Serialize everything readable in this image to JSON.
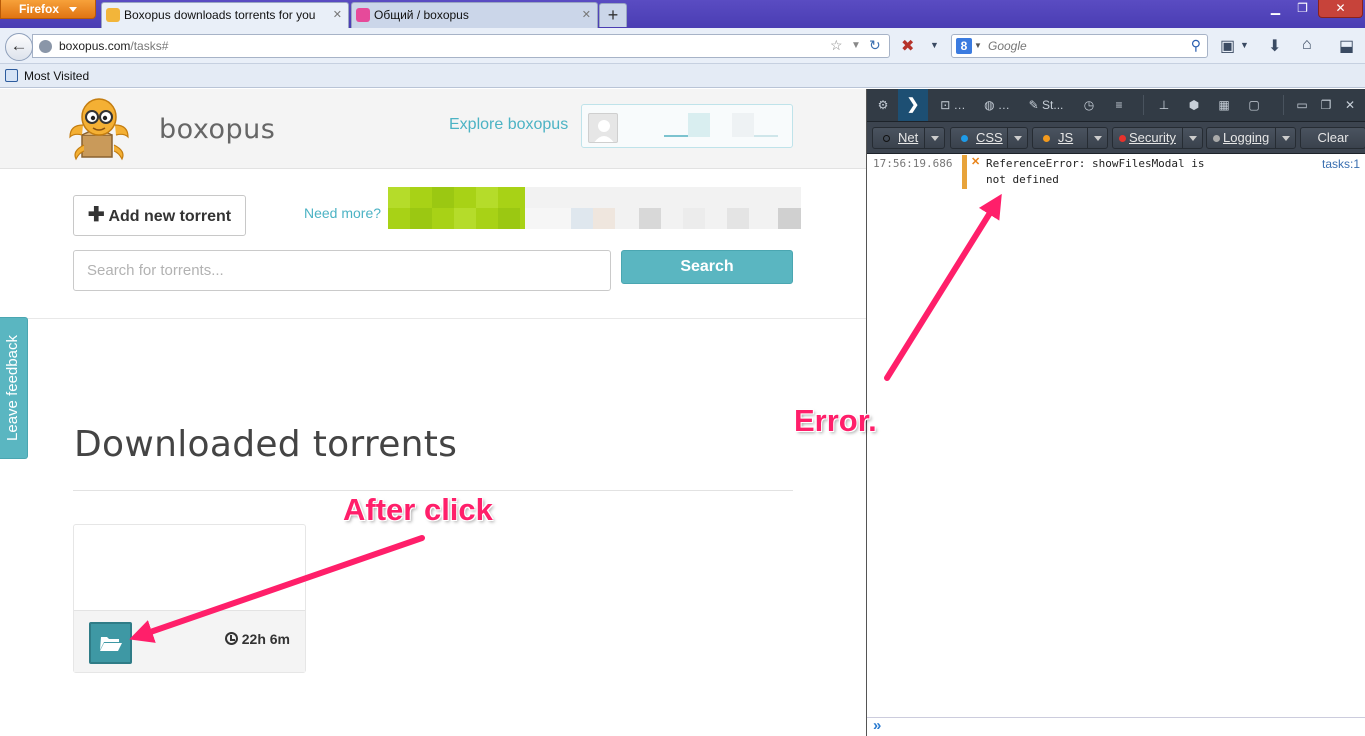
{
  "browser": {
    "menu_label": "Firefox",
    "tabs": [
      {
        "title": "Boxopus downloads torrents for you"
      },
      {
        "title": "Общий / boxopus"
      }
    ],
    "newtab_label": "+",
    "url_host": "boxopus.com",
    "url_path": "/tasks#",
    "search_engine_placeholder": "Google",
    "bookmarks": [
      "Most Visited"
    ]
  },
  "site": {
    "brand": "boxopus",
    "explore_link": "Explore boxopus",
    "add_torrent_label": "Add new torrent",
    "need_more_label": "Need more?",
    "search_placeholder": "Search for torrents...",
    "search_button": "Search",
    "feedback_label": "Leave feedback",
    "downloaded_title": "Downloaded torrents",
    "torrent_time": "22h 6m"
  },
  "devtools": {
    "tools": [
      "St..."
    ],
    "filters": [
      {
        "label": "Net",
        "color": "#222222"
      },
      {
        "label": "CSS",
        "color": "#1e9be8"
      },
      {
        "label": "JS",
        "color": "#f39a1d"
      },
      {
        "label": "Security",
        "color": "#e8322c"
      },
      {
        "label": "Logging",
        "color": "#aaaaaa"
      }
    ],
    "clear_label": "Clear",
    "log": {
      "time": "17:56:19.686",
      "message": "ReferenceError: showFilesModal is not defined",
      "source": "tasks:1"
    },
    "input_prompt": "»"
  },
  "annotations": {
    "error_label": "Error.",
    "after_click_label": "After click",
    "color": "#ff1f6a"
  }
}
